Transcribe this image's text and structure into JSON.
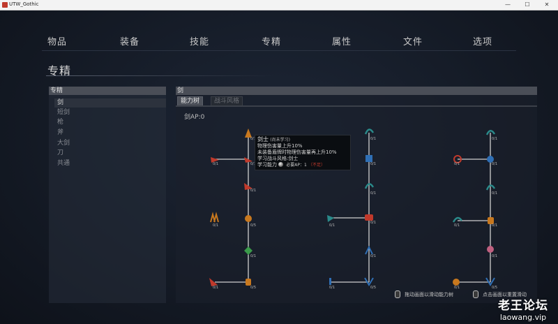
{
  "window": {
    "title": "UTW_Gothic",
    "minimize": "—",
    "maximize": "☐",
    "close": "✕"
  },
  "nav": {
    "items": [
      "物品",
      "装备",
      "技能",
      "专精",
      "属性",
      "文件",
      "选项"
    ]
  },
  "page": {
    "title": "专精"
  },
  "left_panel": {
    "header": "专精",
    "weapon_types": [
      "剑",
      "短剑",
      "枪",
      "斧",
      "大剑",
      "刀",
      "共通"
    ],
    "selected_index": 0
  },
  "right_panel": {
    "header": "剑",
    "tabs": [
      "能力树",
      "战斗风格"
    ],
    "active_tab": 0,
    "ap_label": "剑AP:0"
  },
  "tree": {
    "node_progress": "0/1",
    "node_progress_alt": "0/5",
    "colors": {
      "line": "#d0d0d0",
      "red": "#c0392b",
      "blue": "#2f6fb5",
      "teal": "#2a8a8a",
      "green": "#3a9a4a",
      "orange": "#c8781e",
      "pink": "#c06080"
    }
  },
  "tooltip": {
    "title": "剑士",
    "state": "(尚未学习)",
    "lines": [
      "物理伤害量上升10%",
      "未装备盾牌时物理伤害量再上升10%",
      "学习战斗风格:剑士"
    ],
    "learn_label": "学习能力",
    "required_ap": "必要AP：1",
    "need_label": "（不足）",
    "learn_icon": "coin-icon"
  },
  "hints": {
    "drag": "拖动画面以滑动能力树",
    "click": "点击画面以重置滑动",
    "icon": "mouse-icon"
  },
  "watermark": {
    "main": "老王论坛",
    "sub": "laowang.vip"
  }
}
